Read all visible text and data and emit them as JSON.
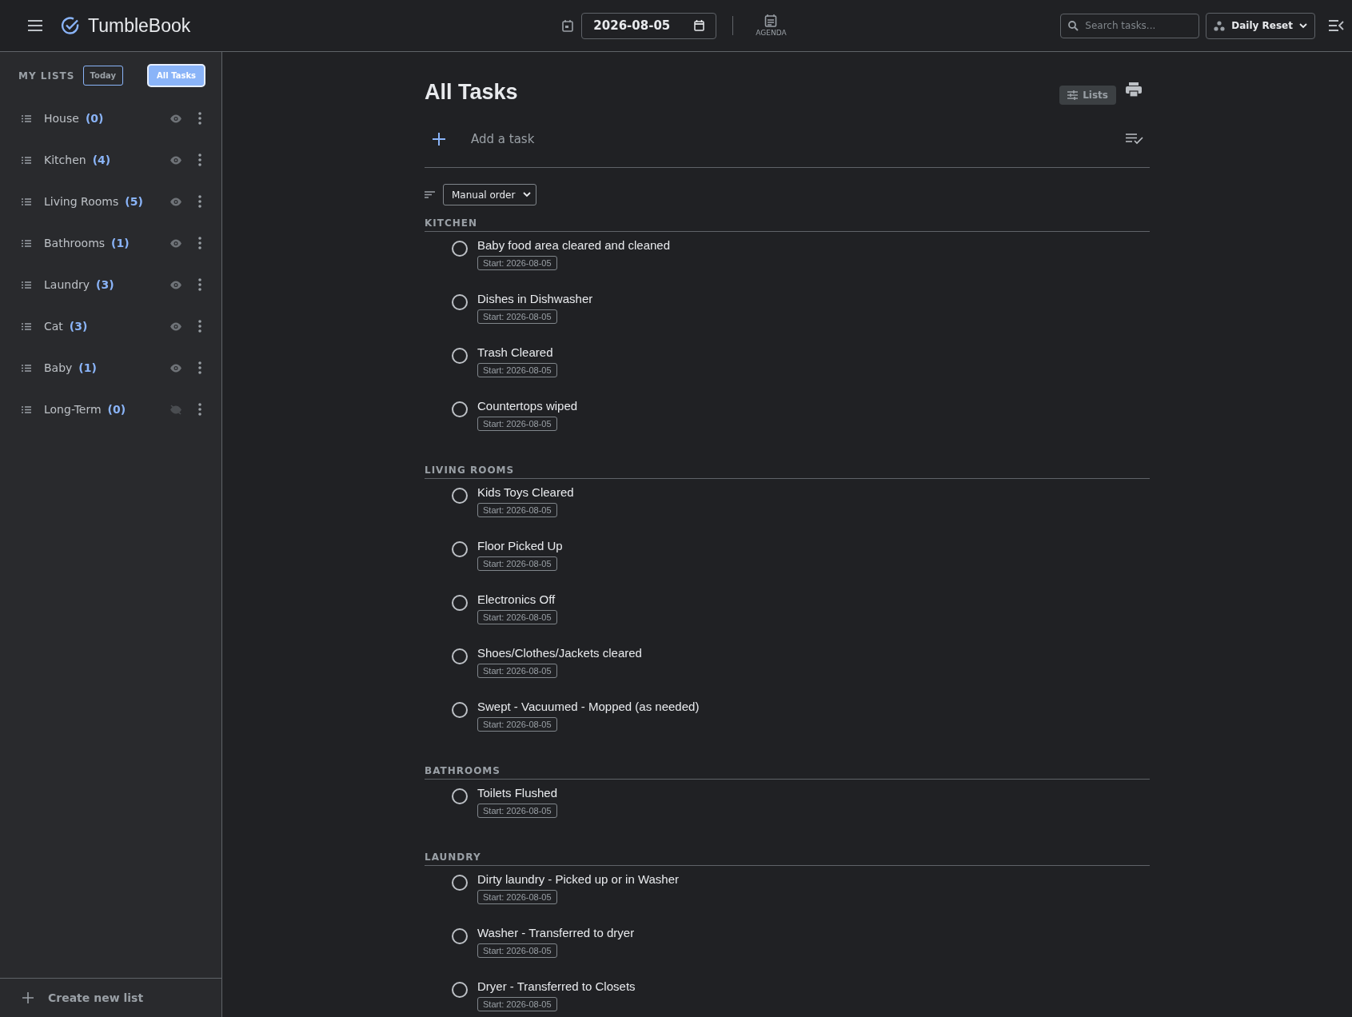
{
  "header": {
    "app_name": "TumbleBook",
    "date_value": "2026-08-05",
    "agenda_label": "AGENDA",
    "search_placeholder": "Search tasks...",
    "reset_label": "Daily Reset"
  },
  "sidebar": {
    "heading": "MY LISTS",
    "filters": [
      {
        "label": "Today",
        "selected": false
      },
      {
        "label": "All Tasks",
        "selected": true
      }
    ],
    "lists": [
      {
        "name": "House",
        "count": "(0)",
        "visible": true
      },
      {
        "name": "Kitchen",
        "count": "(4)",
        "visible": true
      },
      {
        "name": "Living Rooms",
        "count": "(5)",
        "visible": true
      },
      {
        "name": "Bathrooms",
        "count": "(1)",
        "visible": true
      },
      {
        "name": "Laundry",
        "count": "(3)",
        "visible": true
      },
      {
        "name": "Cat",
        "count": "(3)",
        "visible": true
      },
      {
        "name": "Baby",
        "count": "(1)",
        "visible": true
      },
      {
        "name": "Long-Term",
        "count": "(0)",
        "visible": false
      }
    ],
    "create_label": "Create new list"
  },
  "main": {
    "title": "All Tasks",
    "lists_button": "Lists",
    "add_placeholder": "Add a task",
    "sort": "Manual order",
    "sections": [
      {
        "title": "KITCHEN",
        "tasks": [
          {
            "title": "Baby food area cleared and cleaned",
            "tag": "Start: 2026-08-05",
            "checked": false
          },
          {
            "title": "Dishes in Dishwasher",
            "tag": "Start: 2026-08-05",
            "checked": false
          },
          {
            "title": "Trash Cleared",
            "tag": "Start: 2026-08-05",
            "checked": false
          },
          {
            "title": "Countertops wiped",
            "tag": "Start: 2026-08-05",
            "checked": false
          }
        ]
      },
      {
        "title": "LIVING ROOMS",
        "tasks": [
          {
            "title": "Kids Toys Cleared",
            "tag": "Start: 2026-08-05",
            "checked": false
          },
          {
            "title": "Floor Picked Up",
            "tag": "Start: 2026-08-05",
            "checked": false
          },
          {
            "title": "Electronics Off",
            "tag": "Start: 2026-08-05",
            "checked": false
          },
          {
            "title": "Shoes/Clothes/Jackets cleared",
            "tag": "Start: 2026-08-05",
            "checked": false
          },
          {
            "title": "Swept - Vacuumed - Mopped (as needed)",
            "tag": "Start: 2026-08-05",
            "checked": false
          }
        ]
      },
      {
        "title": "BATHROOMS",
        "tasks": [
          {
            "title": "Toilets Flushed",
            "tag": "Start: 2026-08-05",
            "checked": false
          }
        ]
      },
      {
        "title": "LAUNDRY",
        "tasks": [
          {
            "title": "Dirty laundry - Picked up or in Washer",
            "tag": "Start: 2026-08-05",
            "checked": false
          },
          {
            "title": "Washer - Transferred to dryer",
            "tag": "Start: 2026-08-05",
            "checked": false
          },
          {
            "title": "Dryer - Transferred to Closets",
            "tag": "Start: 2026-08-05",
            "checked": false
          }
        ]
      }
    ]
  }
}
